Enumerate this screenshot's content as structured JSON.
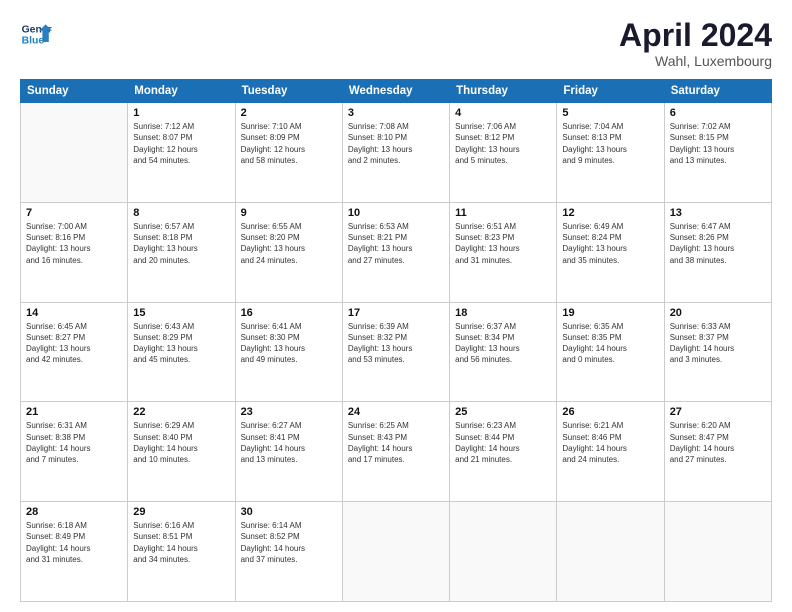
{
  "header": {
    "logo_line1": "General",
    "logo_line2": "Blue",
    "month": "April 2024",
    "location": "Wahl, Luxembourg"
  },
  "weekdays": [
    "Sunday",
    "Monday",
    "Tuesday",
    "Wednesday",
    "Thursday",
    "Friday",
    "Saturday"
  ],
  "weeks": [
    [
      {
        "day": "",
        "info": ""
      },
      {
        "day": "1",
        "info": "Sunrise: 7:12 AM\nSunset: 8:07 PM\nDaylight: 12 hours\nand 54 minutes."
      },
      {
        "day": "2",
        "info": "Sunrise: 7:10 AM\nSunset: 8:09 PM\nDaylight: 12 hours\nand 58 minutes."
      },
      {
        "day": "3",
        "info": "Sunrise: 7:08 AM\nSunset: 8:10 PM\nDaylight: 13 hours\nand 2 minutes."
      },
      {
        "day": "4",
        "info": "Sunrise: 7:06 AM\nSunset: 8:12 PM\nDaylight: 13 hours\nand 5 minutes."
      },
      {
        "day": "5",
        "info": "Sunrise: 7:04 AM\nSunset: 8:13 PM\nDaylight: 13 hours\nand 9 minutes."
      },
      {
        "day": "6",
        "info": "Sunrise: 7:02 AM\nSunset: 8:15 PM\nDaylight: 13 hours\nand 13 minutes."
      }
    ],
    [
      {
        "day": "7",
        "info": "Sunrise: 7:00 AM\nSunset: 8:16 PM\nDaylight: 13 hours\nand 16 minutes."
      },
      {
        "day": "8",
        "info": "Sunrise: 6:57 AM\nSunset: 8:18 PM\nDaylight: 13 hours\nand 20 minutes."
      },
      {
        "day": "9",
        "info": "Sunrise: 6:55 AM\nSunset: 8:20 PM\nDaylight: 13 hours\nand 24 minutes."
      },
      {
        "day": "10",
        "info": "Sunrise: 6:53 AM\nSunset: 8:21 PM\nDaylight: 13 hours\nand 27 minutes."
      },
      {
        "day": "11",
        "info": "Sunrise: 6:51 AM\nSunset: 8:23 PM\nDaylight: 13 hours\nand 31 minutes."
      },
      {
        "day": "12",
        "info": "Sunrise: 6:49 AM\nSunset: 8:24 PM\nDaylight: 13 hours\nand 35 minutes."
      },
      {
        "day": "13",
        "info": "Sunrise: 6:47 AM\nSunset: 8:26 PM\nDaylight: 13 hours\nand 38 minutes."
      }
    ],
    [
      {
        "day": "14",
        "info": "Sunrise: 6:45 AM\nSunset: 8:27 PM\nDaylight: 13 hours\nand 42 minutes."
      },
      {
        "day": "15",
        "info": "Sunrise: 6:43 AM\nSunset: 8:29 PM\nDaylight: 13 hours\nand 45 minutes."
      },
      {
        "day": "16",
        "info": "Sunrise: 6:41 AM\nSunset: 8:30 PM\nDaylight: 13 hours\nand 49 minutes."
      },
      {
        "day": "17",
        "info": "Sunrise: 6:39 AM\nSunset: 8:32 PM\nDaylight: 13 hours\nand 53 minutes."
      },
      {
        "day": "18",
        "info": "Sunrise: 6:37 AM\nSunset: 8:34 PM\nDaylight: 13 hours\nand 56 minutes."
      },
      {
        "day": "19",
        "info": "Sunrise: 6:35 AM\nSunset: 8:35 PM\nDaylight: 14 hours\nand 0 minutes."
      },
      {
        "day": "20",
        "info": "Sunrise: 6:33 AM\nSunset: 8:37 PM\nDaylight: 14 hours\nand 3 minutes."
      }
    ],
    [
      {
        "day": "21",
        "info": "Sunrise: 6:31 AM\nSunset: 8:38 PM\nDaylight: 14 hours\nand 7 minutes."
      },
      {
        "day": "22",
        "info": "Sunrise: 6:29 AM\nSunset: 8:40 PM\nDaylight: 14 hours\nand 10 minutes."
      },
      {
        "day": "23",
        "info": "Sunrise: 6:27 AM\nSunset: 8:41 PM\nDaylight: 14 hours\nand 13 minutes."
      },
      {
        "day": "24",
        "info": "Sunrise: 6:25 AM\nSunset: 8:43 PM\nDaylight: 14 hours\nand 17 minutes."
      },
      {
        "day": "25",
        "info": "Sunrise: 6:23 AM\nSunset: 8:44 PM\nDaylight: 14 hours\nand 21 minutes."
      },
      {
        "day": "26",
        "info": "Sunrise: 6:21 AM\nSunset: 8:46 PM\nDaylight: 14 hours\nand 24 minutes."
      },
      {
        "day": "27",
        "info": "Sunrise: 6:20 AM\nSunset: 8:47 PM\nDaylight: 14 hours\nand 27 minutes."
      }
    ],
    [
      {
        "day": "28",
        "info": "Sunrise: 6:18 AM\nSunset: 8:49 PM\nDaylight: 14 hours\nand 31 minutes."
      },
      {
        "day": "29",
        "info": "Sunrise: 6:16 AM\nSunset: 8:51 PM\nDaylight: 14 hours\nand 34 minutes."
      },
      {
        "day": "30",
        "info": "Sunrise: 6:14 AM\nSunset: 8:52 PM\nDaylight: 14 hours\nand 37 minutes."
      },
      {
        "day": "",
        "info": ""
      },
      {
        "day": "",
        "info": ""
      },
      {
        "day": "",
        "info": ""
      },
      {
        "day": "",
        "info": ""
      }
    ]
  ]
}
